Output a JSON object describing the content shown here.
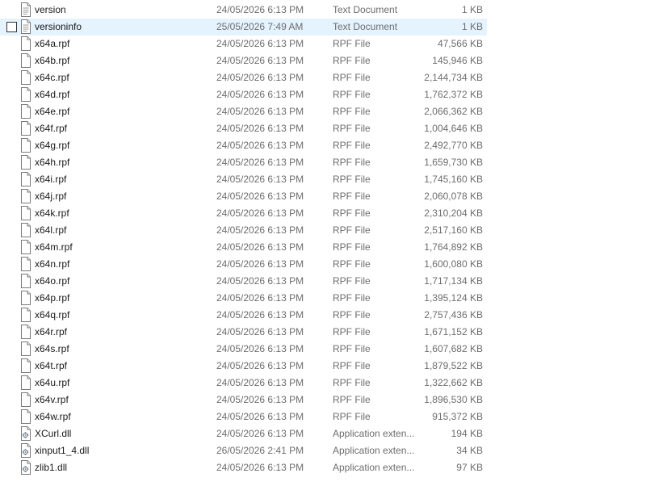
{
  "files": [
    {
      "name": "version",
      "date": "24/05/2026 6:13 PM",
      "type": "Text Document",
      "size": "1 KB",
      "icon": "text-document-icon"
    },
    {
      "name": "versioninfo",
      "date": "25/05/2026 7:49 AM",
      "type": "Text Document",
      "size": "1 KB",
      "icon": "text-document-icon",
      "selected": true
    },
    {
      "name": "x64a.rpf",
      "date": "24/05/2026 6:13 PM",
      "type": "RPF File",
      "size": "47,566 KB",
      "icon": "file-icon"
    },
    {
      "name": "x64b.rpf",
      "date": "24/05/2026 6:13 PM",
      "type": "RPF File",
      "size": "145,946 KB",
      "icon": "file-icon"
    },
    {
      "name": "x64c.rpf",
      "date": "24/05/2026 6:13 PM",
      "type": "RPF File",
      "size": "2,144,734 KB",
      "icon": "file-icon"
    },
    {
      "name": "x64d.rpf",
      "date": "24/05/2026 6:13 PM",
      "type": "RPF File",
      "size": "1,762,372 KB",
      "icon": "file-icon"
    },
    {
      "name": "x64e.rpf",
      "date": "24/05/2026 6:13 PM",
      "type": "RPF File",
      "size": "2,066,362 KB",
      "icon": "file-icon"
    },
    {
      "name": "x64f.rpf",
      "date": "24/05/2026 6:13 PM",
      "type": "RPF File",
      "size": "1,004,646 KB",
      "icon": "file-icon"
    },
    {
      "name": "x64g.rpf",
      "date": "24/05/2026 6:13 PM",
      "type": "RPF File",
      "size": "2,492,770 KB",
      "icon": "file-icon"
    },
    {
      "name": "x64h.rpf",
      "date": "24/05/2026 6:13 PM",
      "type": "RPF File",
      "size": "1,659,730 KB",
      "icon": "file-icon"
    },
    {
      "name": "x64i.rpf",
      "date": "24/05/2026 6:13 PM",
      "type": "RPF File",
      "size": "1,745,160 KB",
      "icon": "file-icon"
    },
    {
      "name": "x64j.rpf",
      "date": "24/05/2026 6:13 PM",
      "type": "RPF File",
      "size": "2,060,078 KB",
      "icon": "file-icon"
    },
    {
      "name": "x64k.rpf",
      "date": "24/05/2026 6:13 PM",
      "type": "RPF File",
      "size": "2,310,204 KB",
      "icon": "file-icon"
    },
    {
      "name": "x64l.rpf",
      "date": "24/05/2026 6:13 PM",
      "type": "RPF File",
      "size": "2,517,160 KB",
      "icon": "file-icon"
    },
    {
      "name": "x64m.rpf",
      "date": "24/05/2026 6:13 PM",
      "type": "RPF File",
      "size": "1,764,892 KB",
      "icon": "file-icon"
    },
    {
      "name": "x64n.rpf",
      "date": "24/05/2026 6:13 PM",
      "type": "RPF File",
      "size": "1,600,080 KB",
      "icon": "file-icon"
    },
    {
      "name": "x64o.rpf",
      "date": "24/05/2026 6:13 PM",
      "type": "RPF File",
      "size": "1,717,134 KB",
      "icon": "file-icon"
    },
    {
      "name": "x64p.rpf",
      "date": "24/05/2026 6:13 PM",
      "type": "RPF File",
      "size": "1,395,124 KB",
      "icon": "file-icon"
    },
    {
      "name": "x64q.rpf",
      "date": "24/05/2026 6:13 PM",
      "type": "RPF File",
      "size": "2,757,436 KB",
      "icon": "file-icon"
    },
    {
      "name": "x64r.rpf",
      "date": "24/05/2026 6:13 PM",
      "type": "RPF File",
      "size": "1,671,152 KB",
      "icon": "file-icon"
    },
    {
      "name": "x64s.rpf",
      "date": "24/05/2026 6:13 PM",
      "type": "RPF File",
      "size": "1,607,682 KB",
      "icon": "file-icon"
    },
    {
      "name": "x64t.rpf",
      "date": "24/05/2026 6:13 PM",
      "type": "RPF File",
      "size": "1,879,522 KB",
      "icon": "file-icon"
    },
    {
      "name": "x64u.rpf",
      "date": "24/05/2026 6:13 PM",
      "type": "RPF File",
      "size": "1,322,662 KB",
      "icon": "file-icon"
    },
    {
      "name": "x64v.rpf",
      "date": "24/05/2026 6:13 PM",
      "type": "RPF File",
      "size": "1,896,530 KB",
      "icon": "file-icon"
    },
    {
      "name": "x64w.rpf",
      "date": "24/05/2026 6:13 PM",
      "type": "RPF File",
      "size": "915,372 KB",
      "icon": "file-icon"
    },
    {
      "name": "XCurl.dll",
      "date": "24/05/2026 6:13 PM",
      "type": "Application exten...",
      "size": "194 KB",
      "icon": "dll-file-icon"
    },
    {
      "name": "xinput1_4.dll",
      "date": "26/05/2026 2:41 PM",
      "type": "Application exten...",
      "size": "34 KB",
      "icon": "dll-file-icon"
    },
    {
      "name": "zlib1.dll",
      "date": "24/05/2026 6:13 PM",
      "type": "Application exten...",
      "size": "97 KB",
      "icon": "dll-file-icon"
    }
  ],
  "colors": {
    "selected_row": "#e5f3ff",
    "secondary_text": "#6d6d6d",
    "primary_text": "#1a1a1a"
  }
}
